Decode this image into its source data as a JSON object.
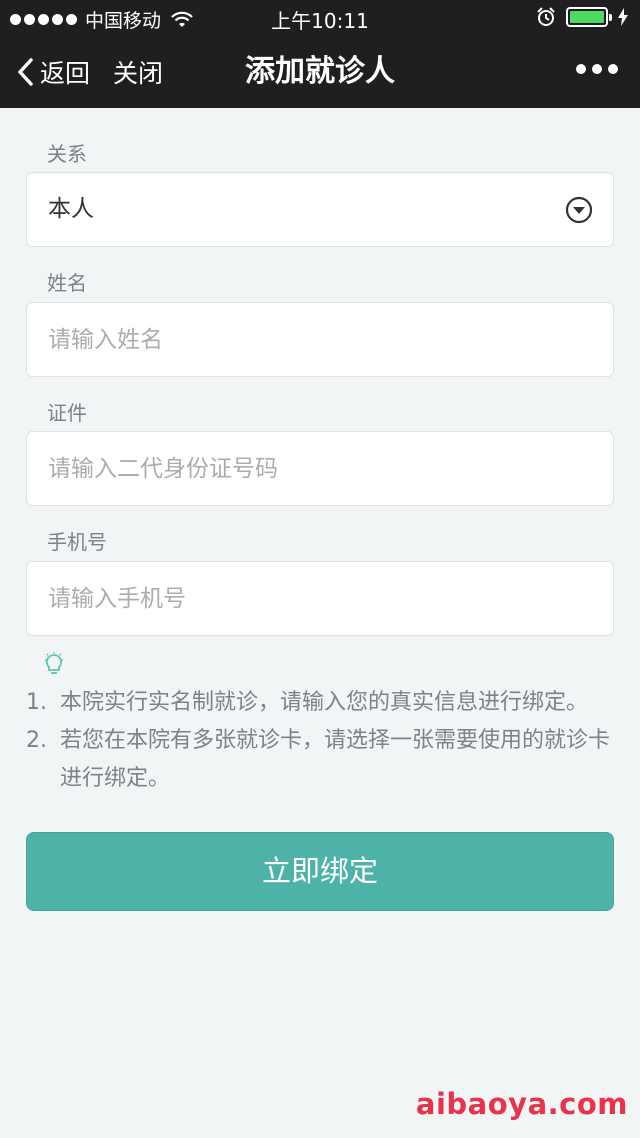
{
  "status_bar": {
    "carrier": "中国移动",
    "time": "上午10:11"
  },
  "nav": {
    "back_label": "返回",
    "close_label": "关闭",
    "title": "添加就诊人"
  },
  "form": {
    "relation": {
      "label": "关系",
      "value": "本人"
    },
    "name": {
      "label": "姓名",
      "placeholder": "请输入姓名"
    },
    "id_card": {
      "label": "证件",
      "placeholder": "请输入二代身份证号码"
    },
    "phone": {
      "label": "手机号",
      "placeholder": "请输入手机号"
    }
  },
  "tips": [
    {
      "num": "1.",
      "text": "本院实行实名制就诊，请输入您的真实信息进行绑定。"
    },
    {
      "num": "2.",
      "text": "若您在本院有多张就诊卡，请选择一张需要使用的就诊卡进行绑定。"
    }
  ],
  "submit_label": "立即绑定",
  "watermark": "aibaoya.com",
  "colors": {
    "accent": "#4db3a8",
    "bar_background": "#1f1f21",
    "page_background": "#f1f5f6",
    "tip_icon": "#5cc6b4"
  }
}
